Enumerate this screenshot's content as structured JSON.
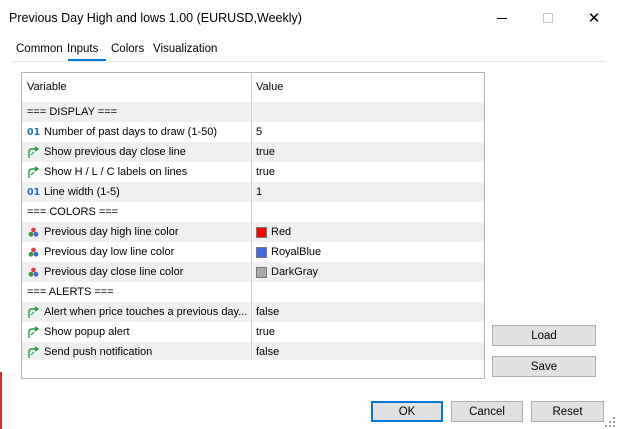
{
  "window": {
    "title": "Previous Day High and lows 1.00 (EURUSD,Weekly)",
    "minimize_icon": "minimize-icon",
    "maximize_icon": "maximize-icon",
    "close_icon": "close-icon",
    "close_glyph": "✕"
  },
  "tabs": [
    {
      "label": "Common",
      "active": false
    },
    {
      "label": "Inputs",
      "active": true
    },
    {
      "label": "Colors",
      "active": false
    },
    {
      "label": "Visualization",
      "active": false
    }
  ],
  "table": {
    "columns": [
      "Variable",
      "Value"
    ],
    "rows": [
      {
        "type": "section",
        "variable": "=== DISPLAY ===",
        "value": ""
      },
      {
        "type": "number",
        "icon": "integer-icon",
        "icon_text": "01",
        "variable": "Number of past days to draw (1-50)",
        "value": "5"
      },
      {
        "type": "bool",
        "icon": "bool-icon",
        "variable": "Show previous day close line",
        "value": "true"
      },
      {
        "type": "bool",
        "icon": "bool-icon",
        "variable": "Show H / L / C labels on lines",
        "value": "true"
      },
      {
        "type": "number",
        "icon": "integer-icon",
        "icon_text": "01",
        "variable": "Line width (1-5)",
        "value": "1"
      },
      {
        "type": "section",
        "variable": "=== COLORS ===",
        "value": ""
      },
      {
        "type": "color",
        "icon": "color-icon",
        "variable": "Previous day high line color",
        "value": "Red",
        "swatch": "#ff0000"
      },
      {
        "type": "color",
        "icon": "color-icon",
        "variable": "Previous day low line color",
        "value": "RoyalBlue",
        "swatch": "#4169e1"
      },
      {
        "type": "color",
        "icon": "color-icon",
        "variable": "Previous day close line color",
        "value": "DarkGray",
        "swatch": "#a9a9a9"
      },
      {
        "type": "section",
        "variable": "=== ALERTS ===",
        "value": ""
      },
      {
        "type": "bool",
        "icon": "bool-icon",
        "variable": "Alert when price touches a previous day...",
        "value": "false"
      },
      {
        "type": "bool",
        "icon": "bool-icon",
        "variable": "Show popup alert",
        "value": "true"
      },
      {
        "type": "bool",
        "icon": "bool-icon",
        "variable": "Send push notification",
        "value": "false"
      }
    ]
  },
  "side_buttons": {
    "load": "Load",
    "save": "Save"
  },
  "footer_buttons": {
    "ok": "OK",
    "cancel": "Cancel",
    "reset": "Reset"
  },
  "colors": {
    "accent": "#0078d7",
    "alt_row": "#f0f0f0",
    "button_bg": "#e1e1e1"
  }
}
